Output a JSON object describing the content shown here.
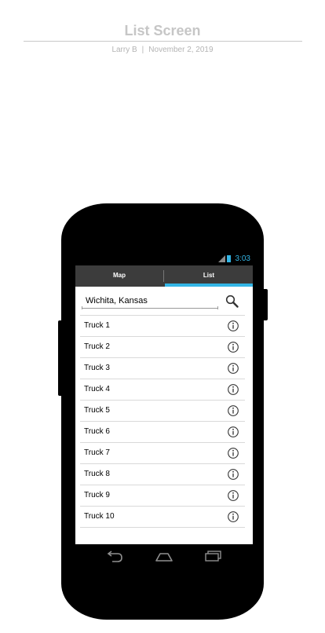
{
  "header": {
    "title": "List Screen",
    "author": "Larry B",
    "separator": "|",
    "date": "November 2, 2019"
  },
  "status_bar": {
    "time": "3:03",
    "icons": [
      "signal-icon",
      "battery-icon"
    ],
    "accent_color": "#33b5e5"
  },
  "tabs": [
    {
      "label": "Map",
      "selected": false
    },
    {
      "label": "List",
      "selected": true
    }
  ],
  "search": {
    "value": "Wichita, Kansas",
    "icon": "search-icon"
  },
  "list": {
    "item_icon": "info-icon",
    "items": [
      {
        "label": "Truck 1"
      },
      {
        "label": "Truck 2"
      },
      {
        "label": "Truck 3"
      },
      {
        "label": "Truck 4"
      },
      {
        "label": "Truck 5"
      },
      {
        "label": "Truck 6"
      },
      {
        "label": "Truck 7"
      },
      {
        "label": "Truck 8"
      },
      {
        "label": "Truck 9"
      },
      {
        "label": "Truck 10"
      }
    ]
  },
  "nav_bar": {
    "icons": [
      "back-icon",
      "home-icon",
      "recents-icon"
    ]
  }
}
